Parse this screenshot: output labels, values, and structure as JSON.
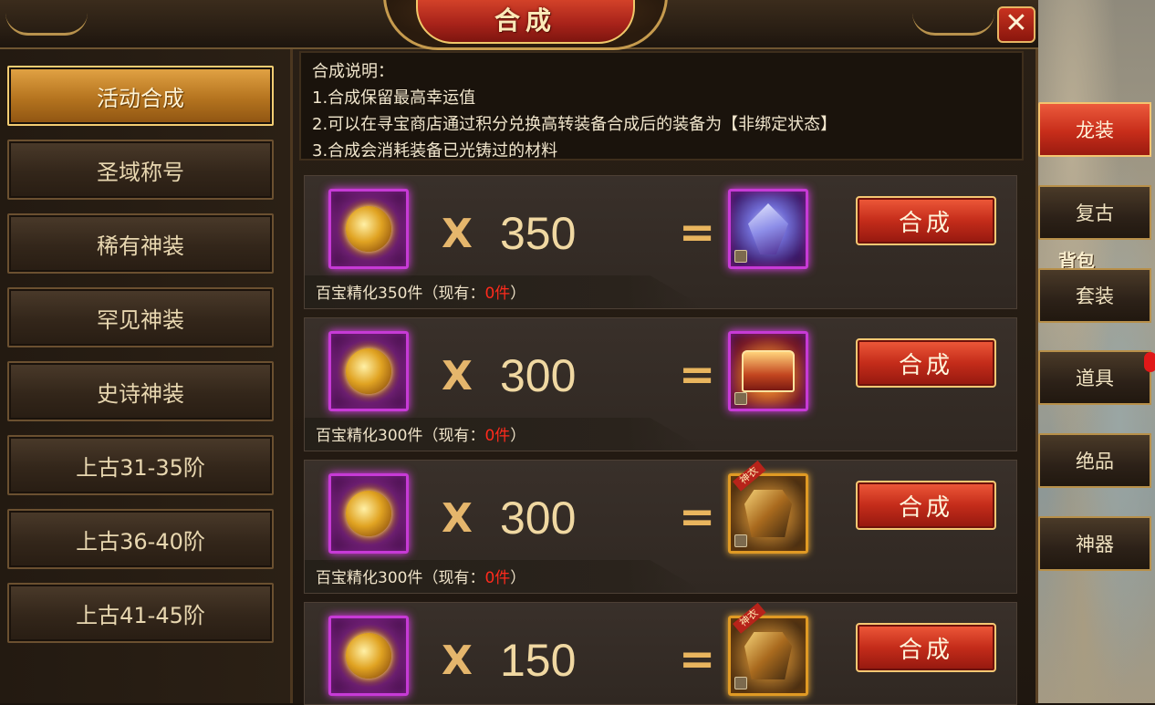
{
  "window": {
    "title": "合成",
    "close_icon": "close-icon",
    "accent": "#c42c1a"
  },
  "left_nav": {
    "items": [
      {
        "label": "活动合成",
        "active": true
      },
      {
        "label": "圣域称号",
        "active": false
      },
      {
        "label": "稀有神装",
        "active": false
      },
      {
        "label": "罕见神装",
        "active": false
      },
      {
        "label": "史诗神装",
        "active": false
      },
      {
        "label": "上古31-35阶",
        "active": false
      },
      {
        "label": "上古36-40阶",
        "active": false
      },
      {
        "label": "上古41-45阶",
        "active": false
      }
    ]
  },
  "description": {
    "lines": [
      "合成说明：",
      "1.合成保留最高幸运值",
      "2.可以在寻宝商店通过积分兑换高转装备合成后的装备为【非绑定状态】",
      "3.合成会消耗装备已光铸过的材料"
    ]
  },
  "recipes": [
    {
      "material_icon": "gold-orb-icon",
      "times": "X",
      "quantity": "350",
      "equals": "=",
      "result_icon": "crystal-dragon-icon",
      "craft_label": "合成",
      "caption_prefix": "百宝精化350件（现有：",
      "owned": "0件",
      "caption_suffix": "）"
    },
    {
      "material_icon": "gold-orb-icon",
      "times": "X",
      "quantity": "300",
      "equals": "=",
      "result_icon": "treasure-chest-icon",
      "craft_label": "合成",
      "caption_prefix": "百宝精化300件（现有：",
      "owned": "0件",
      "caption_suffix": "）"
    },
    {
      "material_icon": "gold-orb-icon",
      "times": "X",
      "quantity": "300",
      "equals": "=",
      "result_icon": "divine-armor-icon",
      "result_badge": "神衣",
      "craft_label": "合成",
      "caption_prefix": "百宝精化300件（现有：",
      "owned": "0件",
      "caption_suffix": "）"
    },
    {
      "material_icon": "gold-orb-icon",
      "times": "X",
      "quantity": "150",
      "equals": "=",
      "result_icon": "divine-armor-icon",
      "result_badge": "神衣",
      "craft_label": "合成"
    }
  ],
  "right_tabs": {
    "items": [
      {
        "label": "龙装",
        "active": true
      },
      {
        "label": "复古",
        "active": false
      },
      {
        "label": "套装",
        "active": false
      },
      {
        "label": "道具",
        "active": false
      },
      {
        "label": "绝品",
        "active": false
      },
      {
        "label": "神器",
        "active": false
      }
    ],
    "bag_label": "背包"
  }
}
